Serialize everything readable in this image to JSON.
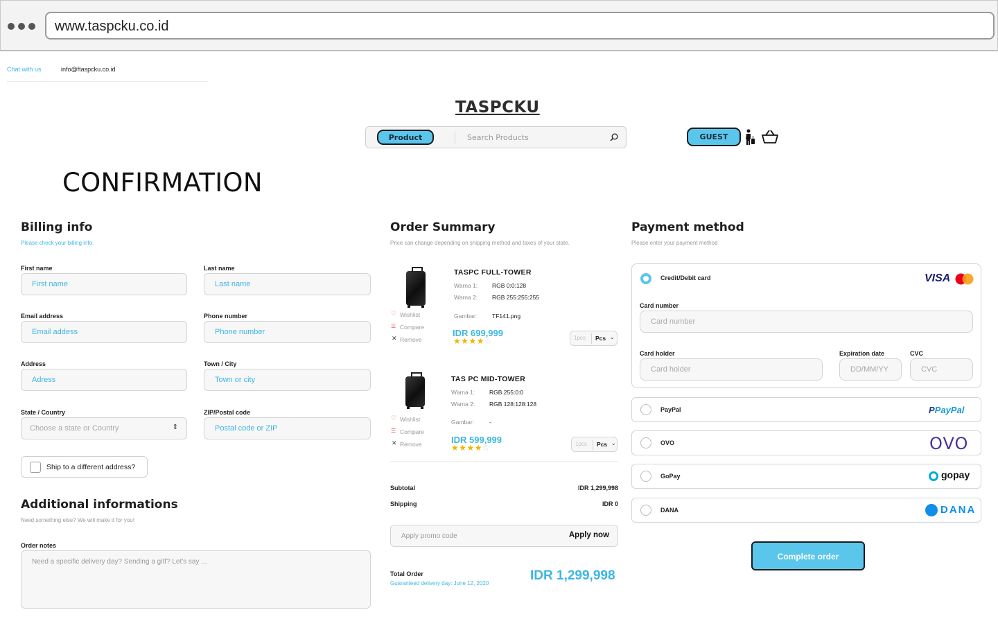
{
  "browser": {
    "url": "www.taspcku.co.id"
  },
  "topbar": {
    "chat_label": "Chat with us",
    "email": "info@ftaspcku.co.id"
  },
  "header": {
    "logo": "TASPCKU",
    "category_button": "Product",
    "search_placeholder": "Search Products",
    "guest_button": "GUEST"
  },
  "page": {
    "title": "CONFIRMATION"
  },
  "billing": {
    "title": "Billing info",
    "subtitle": "Please check your billing info.",
    "first_name": {
      "label": "First name",
      "placeholder": "First name"
    },
    "last_name": {
      "label": "Last name",
      "placeholder": "Last name"
    },
    "email": {
      "label": "Email address",
      "placeholder": "Email addess"
    },
    "phone": {
      "label": "Phone number",
      "placeholder": "Phone number"
    },
    "address": {
      "label": "Address",
      "placeholder": "Adress"
    },
    "town": {
      "label": "Town / City",
      "placeholder": "Town or city"
    },
    "state": {
      "label": "State / Country",
      "placeholder": "Choose a state or Country"
    },
    "zip": {
      "label": "ZIP/Postal code",
      "placeholder": "Postal code or ZIP"
    },
    "ship_different": "Ship to a different address?"
  },
  "additional": {
    "title": "Additional informations",
    "subtitle": "Need something else? We will make it for you!",
    "notes_label": "Order notes",
    "notes_placeholder": "Need a specific delivery day? Sending a gitf? Let's say ..."
  },
  "summary": {
    "title": "Order Summary",
    "subtitle": "Price can change depending on shipping method and taxes of your state.",
    "actions": {
      "wishlist": "Wishlist",
      "compare": "Compare",
      "remove": "Remove"
    },
    "items": [
      {
        "name": "TASPC FULL-TOWER",
        "k1": "Warna 1:",
        "v1": "RGB 0:0:128",
        "k2": "Warna 2:",
        "v2": "RGB 255:255:255",
        "k3": "Gambar:",
        "v3": "TF141.png",
        "price": "IDR 699,999",
        "rating": 4,
        "qty": "1pcs",
        "unit": "Pcs"
      },
      {
        "name": "TAS PC MID-TOWER",
        "k1": "Warna 1:",
        "v1": "RGB 255:0:0",
        "k2": "Warna 2:",
        "v2": "RGB 128:128:128",
        "k3": "Gambar:",
        "v3": "-",
        "price": "IDR 599,999",
        "rating": 4,
        "qty": "1pcs",
        "unit": "Pcs"
      }
    ],
    "subtotal_label": "Subtotal",
    "subtotal": "IDR 1,299,998",
    "shipping_label": "Shipping",
    "shipping": "IDR 0",
    "promo_placeholder": "Apply promo code",
    "promo_button": "Apply now",
    "total_label": "Total Order",
    "delivery_note": "Guaranteed delivery day:  June 12, 2020",
    "total": "IDR 1,299,998"
  },
  "payment": {
    "title": "Payment method",
    "subtitle": "Please enter your payment method",
    "card_option": "Credit/Debit card",
    "visa": "VISA",
    "card_number": {
      "label": "Card number",
      "placeholder": "Card number"
    },
    "card_holder": {
      "label": "Card holder",
      "placeholder": "Card holder"
    },
    "expiry": {
      "label": "Expiration date",
      "placeholder": "DD/MM/YY"
    },
    "cvc": {
      "label": "CVC",
      "placeholder": "CVC"
    },
    "options": [
      {
        "name": "PayPal",
        "brand": "PayPal"
      },
      {
        "name": "OVO",
        "brand": "OVO"
      },
      {
        "name": "GoPay",
        "brand": "gopay"
      },
      {
        "name": "DANA",
        "brand": "DANA"
      }
    ],
    "complete_button": "Complete order"
  },
  "colors": {
    "accent": "#5bc6ec",
    "link": "#3cb6e3",
    "star": "#f0b400",
    "ovo": "#4c3494",
    "paypal_dark": "#253b80",
    "paypal_light": "#179bd7",
    "dana": "#118ee9",
    "gopay": "#00aed6"
  }
}
